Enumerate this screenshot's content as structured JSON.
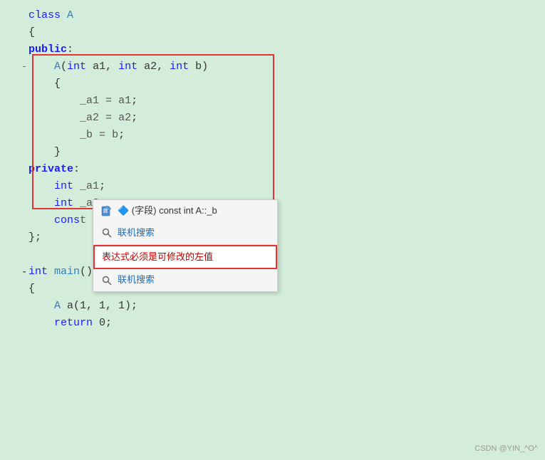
{
  "code": {
    "lines": [
      {
        "indent": "",
        "content": "class A",
        "type": "class-decl"
      },
      {
        "indent": "",
        "content": "{",
        "type": "brace"
      },
      {
        "indent": "",
        "content": "public:",
        "type": "access-spec"
      },
      {
        "indent": "    ",
        "content": "A(int a1, int a2, int b)",
        "type": "constructor-decl"
      },
      {
        "indent": "    ",
        "content": "{",
        "type": "brace"
      },
      {
        "indent": "        ",
        "content": "_a1 = a1;",
        "type": "assign"
      },
      {
        "indent": "        ",
        "content": "_a2 = a2;",
        "type": "assign"
      },
      {
        "indent": "        ",
        "content": "_b = b;",
        "type": "assign"
      },
      {
        "indent": "    ",
        "content": "}",
        "type": "brace"
      },
      {
        "indent": "",
        "content": "private:",
        "type": "access-spec"
      },
      {
        "indent": "    ",
        "content": "int _a1;",
        "type": "field"
      },
      {
        "indent": "    ",
        "content": "int _a2;",
        "type": "field"
      },
      {
        "indent": "    ",
        "content": "const _b;",
        "type": "field"
      },
      {
        "indent": "",
        "content": "};",
        "type": "brace"
      },
      {
        "indent": "",
        "content": "",
        "type": "empty"
      },
      {
        "indent": "",
        "content": "int main()",
        "type": "func-decl"
      },
      {
        "indent": "",
        "content": "{",
        "type": "brace"
      },
      {
        "indent": "    ",
        "content": "A a(1, 1, 1);",
        "type": "stmt"
      },
      {
        "indent": "    ",
        "content": "return 0;",
        "type": "stmt"
      }
    ]
  },
  "context_menu": {
    "item1_icon": "📋",
    "item1_label": "🔷 (字段) const int A::_b",
    "item2_label": "联机搜索",
    "item3_label": "表达式必须是可修改的左值",
    "item4_label": "联机搜索"
  },
  "watermark": "CSDN @YIN_^O^"
}
